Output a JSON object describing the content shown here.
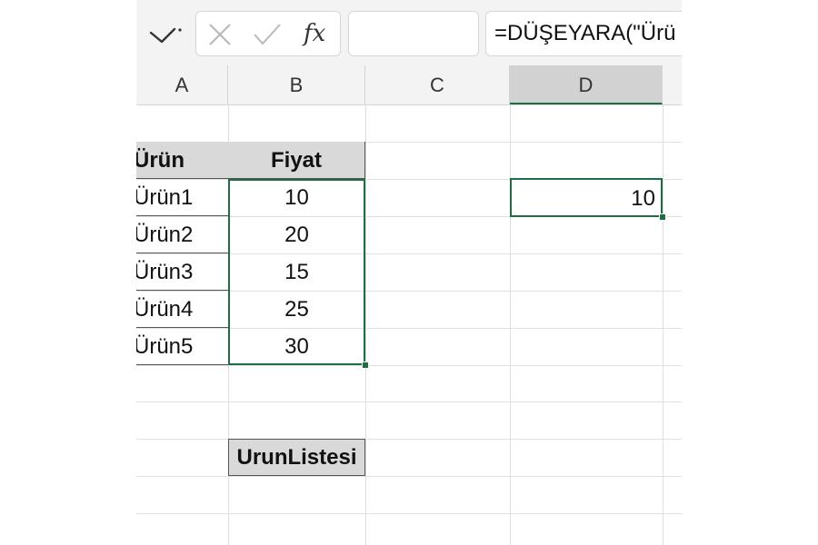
{
  "formula_bar": {
    "cancel_icon": "x-icon",
    "enter_icon": "check-icon",
    "function_label": "fx",
    "name_box_value": "",
    "formula_text": "=DÜŞEYARA(\"Ürü"
  },
  "columns": [
    "A",
    "B",
    "C",
    "D"
  ],
  "active_column": "D",
  "table": {
    "header_product": "Ürün",
    "header_price": "Fiyat",
    "rows": [
      {
        "product": "Ürün1",
        "price": "10"
      },
      {
        "product": "Ürün2",
        "price": "20"
      },
      {
        "product": "Ürün3",
        "price": "15"
      },
      {
        "product": "Ürün4",
        "price": "25"
      },
      {
        "product": "Ürün5",
        "price": "30"
      }
    ]
  },
  "result_cell": "10",
  "named_range_label": "UrunListesi",
  "colors": {
    "selection_green": "#1f6e43",
    "header_fill": "#d9d9d9",
    "toolbar_bg": "#f3f3f3"
  }
}
